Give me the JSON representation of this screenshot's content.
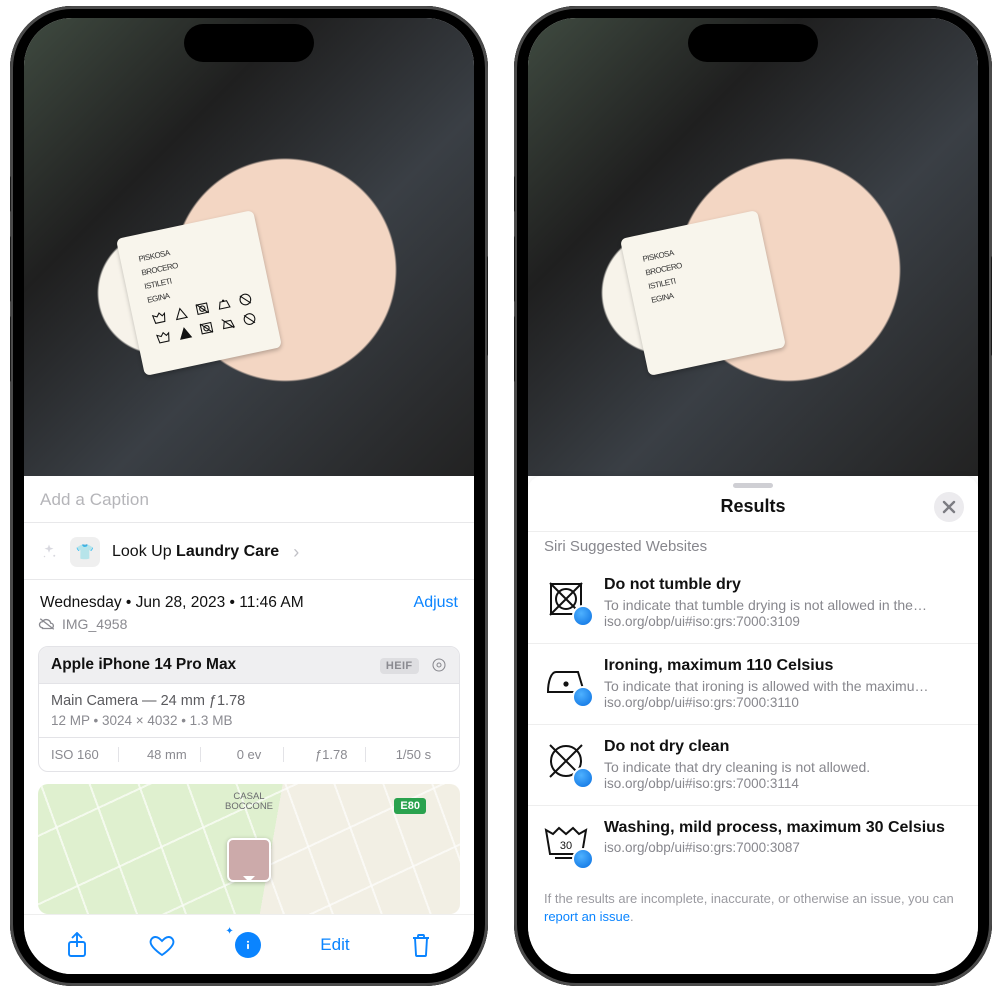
{
  "left": {
    "caption_placeholder": "Add a Caption",
    "lookup_prefix": "Look Up ",
    "lookup_topic": "Laundry Care",
    "date_line": "Wednesday • Jun 28, 2023 • 11:46 AM",
    "adjust_label": "Adjust",
    "filename": "IMG_4958",
    "device": {
      "model": "Apple iPhone 14 Pro Max",
      "format_badge": "HEIF",
      "lens_line": "Main Camera — 24 mm ƒ1.78",
      "meta_line": "12 MP  •  3024 × 4032  •  1.3 MB",
      "exif": [
        "ISO 160",
        "48 mm",
        "0 ev",
        "ƒ1.78",
        "1/50 s"
      ]
    },
    "map": {
      "road_badge": "E80",
      "area_label": "CASAL\nBOCCONE"
    },
    "toolbar": {
      "edit_label": "Edit"
    }
  },
  "right": {
    "sheet_title": "Results",
    "section_label": "Siri Suggested Websites",
    "results": [
      {
        "title": "Do not tumble dry",
        "desc": "To indicate that tumble drying is not allowed in the…",
        "url": "iso.org/obp/ui#iso:grs:7000:3109"
      },
      {
        "title": "Ironing, maximum 110 Celsius",
        "desc": "To indicate that ironing is allowed with the maximu…",
        "url": "iso.org/obp/ui#iso:grs:7000:3110"
      },
      {
        "title": "Do not dry clean",
        "desc": "To indicate that dry cleaning is not allowed.",
        "url": "iso.org/obp/ui#iso:grs:7000:3114"
      },
      {
        "title": "Washing, mild process, maximum 30 Celsius",
        "desc": "",
        "url": "iso.org/obp/ui#iso:grs:7000:3087"
      }
    ],
    "footer_pre": "If the results are incomplete, inaccurate, or otherwise an issue, you can ",
    "footer_link": "report an issue",
    "footer_post": "."
  }
}
